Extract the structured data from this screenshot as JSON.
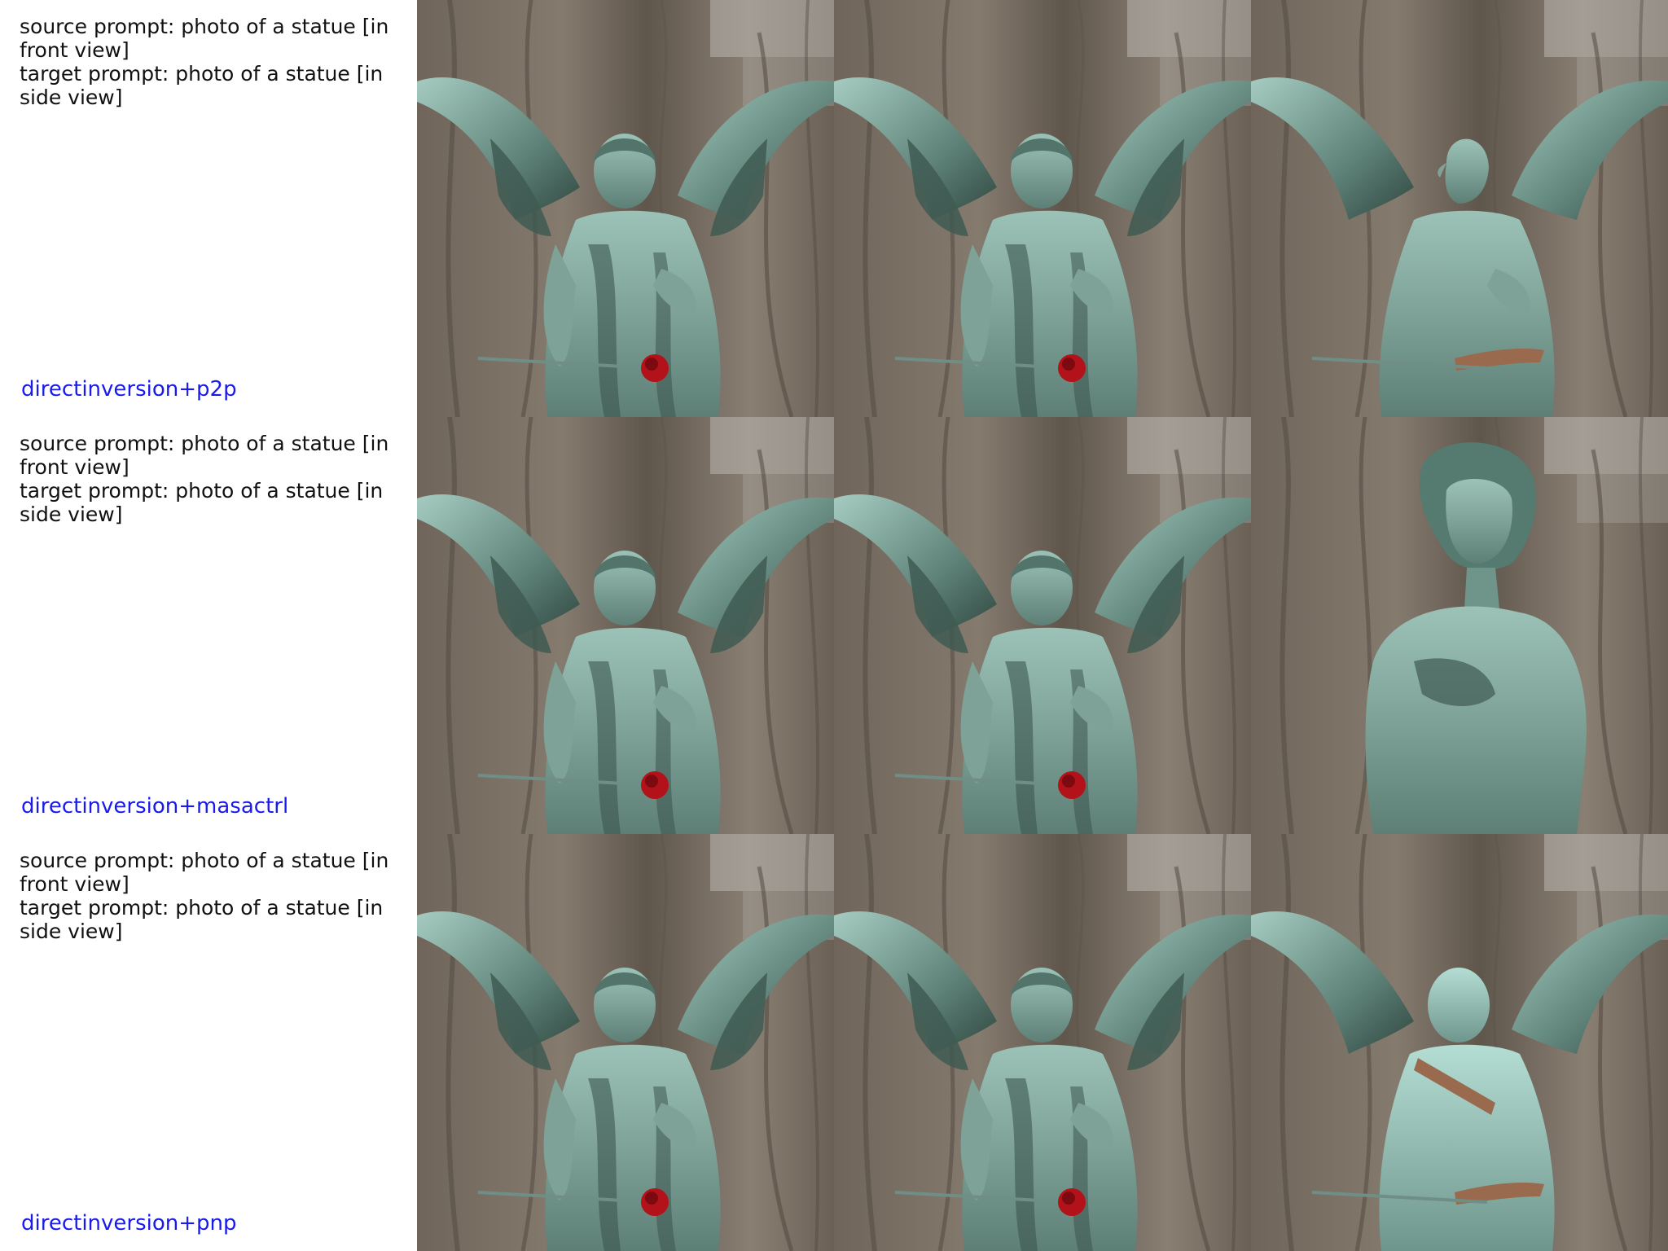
{
  "rows": [
    {
      "source_prompt": "source prompt: photo of a statue [in front view]",
      "target_prompt": "target prompt: photo of a statue [in side view]",
      "method": "directinversion+p2p",
      "images": [
        {
          "variant": "source",
          "subject": "winged angel statue holding red rose, front view"
        },
        {
          "variant": "reconstruction",
          "subject": "winged angel statue holding red rose, front view"
        },
        {
          "variant": "edited",
          "subject": "winged angel statue turned to side, head in profile"
        }
      ]
    },
    {
      "source_prompt": "source prompt: photo of a statue [in front view]",
      "target_prompt": "target prompt: photo of a statue [in side view]",
      "method": "directinversion+masactrl",
      "images": [
        {
          "variant": "source",
          "subject": "winged angel statue holding red rose, front view"
        },
        {
          "variant": "reconstruction",
          "subject": "winged angel statue holding red rose, front view"
        },
        {
          "variant": "edited",
          "subject": "wingless bust statue with curly hair, side view"
        }
      ]
    },
    {
      "source_prompt": "source prompt: photo of a statue [in front view]",
      "target_prompt": "target prompt: photo of a statue [in side view]",
      "method": "directinversion+pnp",
      "images": [
        {
          "variant": "source",
          "subject": "winged angel statue holding red rose, front view"
        },
        {
          "variant": "reconstruction",
          "subject": "winged angel statue holding red rose, front view"
        },
        {
          "variant": "edited",
          "subject": "winged angel statue, brighter patina, front view"
        }
      ]
    }
  ],
  "colors": {
    "background": "#ffffff",
    "prompt_text": "#111111",
    "method_label": "#1a1aee",
    "tree_bark": "#6e6458",
    "patina": "#7fa39a",
    "rose": "#b3121a"
  }
}
